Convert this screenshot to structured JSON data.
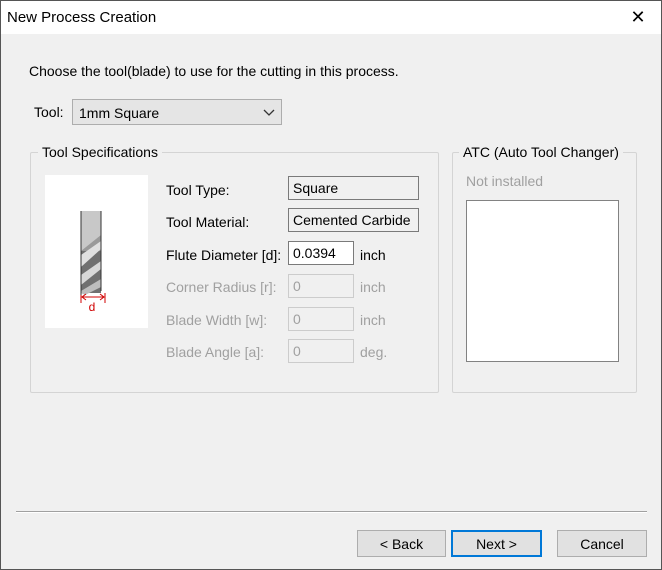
{
  "window": {
    "title": "New Process Creation",
    "close_glyph": "✕"
  },
  "instruction": "Choose the tool(blade) to use for the cutting in this process.",
  "tool": {
    "label": "Tool:",
    "selected": "1mm Square",
    "chevron_icon": "chevron-down-icon"
  },
  "specs": {
    "group_label": "Tool Specifications",
    "image_dimension_label": "d",
    "rows": [
      {
        "label": "Tool Type:",
        "value": "Square",
        "unit": "",
        "enabled": true
      },
      {
        "label": "Tool Material:",
        "value": "Cemented Carbide",
        "unit": "",
        "enabled": true
      },
      {
        "label": "Flute Diameter [d]:",
        "value": "0.0394",
        "unit": "inch",
        "enabled": true
      },
      {
        "label": "Corner Radius [r]:",
        "value": "0",
        "unit": "inch",
        "enabled": false
      },
      {
        "label": "Blade Width [w]:",
        "value": "0",
        "unit": "inch",
        "enabled": false
      },
      {
        "label": "Blade Angle [a]:",
        "value": "0",
        "unit": "deg.",
        "enabled": false
      }
    ]
  },
  "atc": {
    "group_label": "ATC (Auto Tool Changer)",
    "status": "Not installed"
  },
  "buttons": {
    "back": "< Back",
    "next": "Next >",
    "cancel": "Cancel"
  }
}
